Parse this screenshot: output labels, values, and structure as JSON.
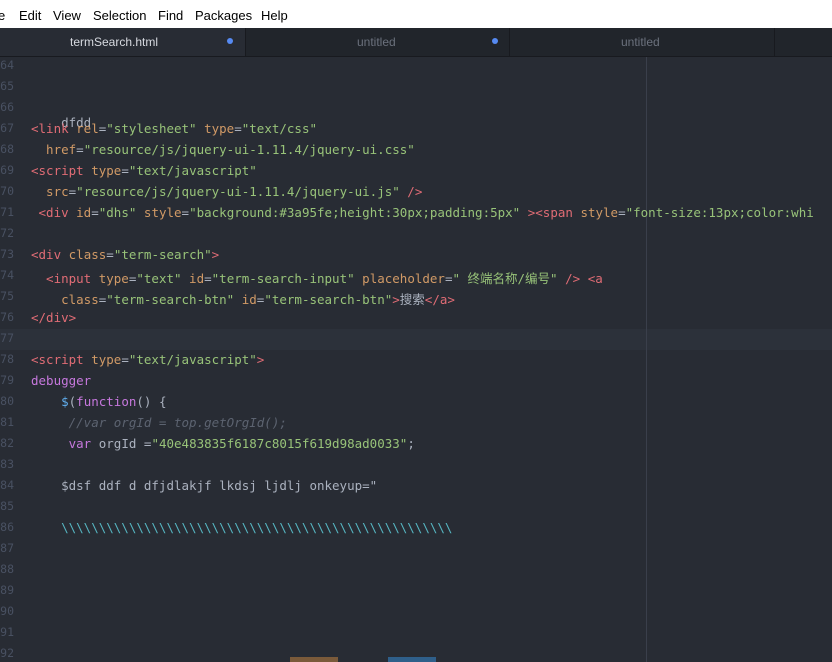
{
  "menu": [
    "e",
    "Edit",
    "View",
    "Selection",
    "Find",
    "Packages",
    "Help"
  ],
  "tabs": [
    {
      "label": "termSearch.html",
      "modified": true,
      "active": true
    },
    {
      "label": "untitled",
      "modified": true,
      "active": false
    },
    {
      "label": "untitled",
      "modified": false,
      "active": false
    }
  ],
  "line_numbers": [
    "64",
    "65",
    "66",
    "67",
    "68",
    "69",
    "70",
    "71",
    "72",
    "73",
    "74",
    "75",
    "76",
    "77",
    "78",
    "79",
    "80",
    "81",
    "82",
    "83",
    "84",
    "85",
    "86",
    "87",
    "88",
    "89",
    "90",
    "91",
    "92"
  ],
  "code": {
    "l66": "dfdd",
    "l67": [
      "<link ",
      "rel",
      "=",
      "\"stylesheet\"",
      " type",
      "=",
      "\"text/css\""
    ],
    "l68": [
      "  href",
      "=",
      "\"resource/js/jquery-ui-1.11.4/jquery-ui.css\""
    ],
    "l69": [
      "<script ",
      "type",
      "=",
      "\"text/javascript\""
    ],
    "l70": [
      "  src",
      "=",
      "\"resource/js/jquery-ui-1.11.4/jquery-ui.js\"",
      " />"
    ],
    "l71": [
      " <div ",
      "id",
      "=",
      "\"dhs\"",
      " style",
      "=",
      "\"background:#3a95fe;height:30px;padding:5px\"",
      " ><span ",
      "style",
      "=",
      "\"font-size:13px;color:whi"
    ],
    "l73": [
      "<div ",
      "class",
      "=",
      "\"term-search\"",
      ">"
    ],
    "l74": [
      "  <input ",
      "type",
      "=",
      "\"text\"",
      " id",
      "=",
      "\"term-search-input\"",
      " placeholder",
      "=",
      "\" 终端名称/编号\"",
      " /> <a"
    ],
    "l75": [
      "    class",
      "=",
      "\"term-search-btn\"",
      " id",
      "=",
      "\"term-search-btn\"",
      ">",
      "搜索",
      "</a>"
    ],
    "l76": "</div>",
    "l78": [
      "<script ",
      "type",
      "=",
      "\"text/javascript\"",
      ">"
    ],
    "l79": "debugger",
    "l80": [
      "    $",
      "(",
      "function",
      "() {"
    ],
    "l81": "     //var orgId = top.getOrgId();",
    "l82": [
      "     var",
      " orgId =",
      "\"40e483835f6187c8015f619d98ad0033\"",
      ";"
    ],
    "l84": "    $dsf ddf d dfjdlakjf lkdsj ljdlj onkeyup=\"",
    "l86": "    \\\\\\\\\\\\\\\\\\\\\\\\\\\\\\\\\\\\\\\\\\\\\\\\\\\\\\\\\\\\\\\\\\\\\\\\\\\\\\\\\\\\\\\\\\\\\\\\\\\\\\\\"
  },
  "colors": {
    "background": "#282c34",
    "tag": "#e06c75",
    "attribute": "#d19a66",
    "string": "#98c379",
    "keyword": "#c678dd",
    "function": "#61afef",
    "comment": "#5c6370",
    "modified_dot": "#568af2"
  }
}
